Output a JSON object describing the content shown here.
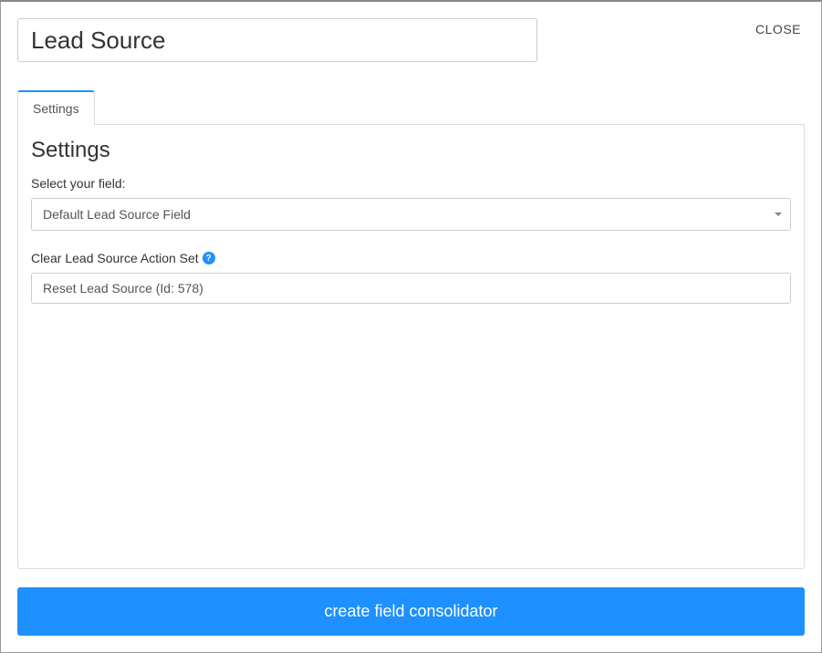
{
  "header": {
    "title_value": "Lead Source",
    "close_label": "CLOSE"
  },
  "tabs": {
    "settings_label": "Settings"
  },
  "panel": {
    "title": "Settings",
    "select_field_label": "Select your field:",
    "select_field_value": "Default Lead Source Field",
    "clear_action_label": "Clear Lead Source Action Set",
    "clear_action_value": "Reset Lead Source (Id: 578)"
  },
  "footer": {
    "submit_label": "create field consolidator"
  }
}
